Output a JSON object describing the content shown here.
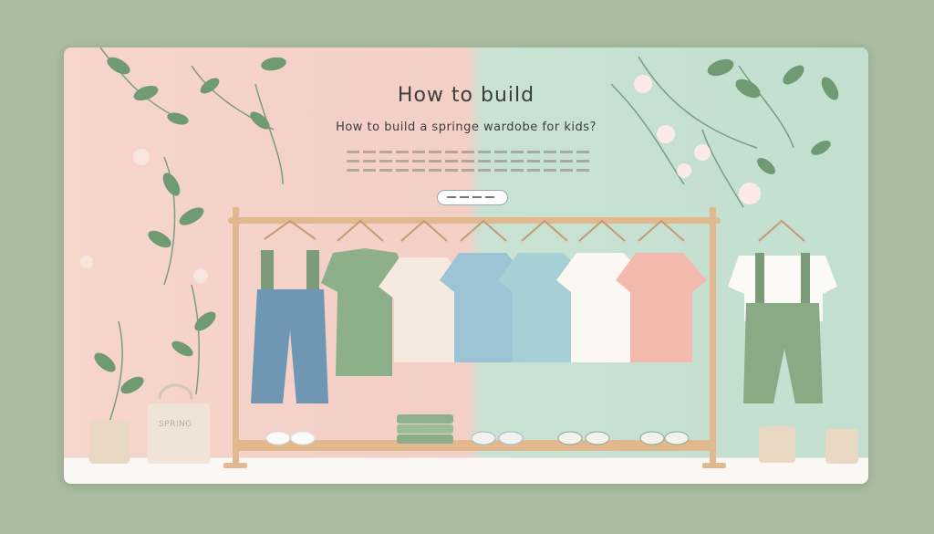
{
  "banner": {
    "title": "How to build",
    "subtitle": "How to build a springe wardobe for kids?",
    "bag_text": "SPRING"
  },
  "colors": {
    "pink_bg": "#f3cfc6",
    "mint_bg": "#c2dfcf",
    "leaf": "#6f9a72",
    "wood": "#e2b98f",
    "outer_bg": "#a9bc9f"
  },
  "icons": [
    "leaf-branch-icon",
    "flower-icon",
    "hanger-icon"
  ]
}
